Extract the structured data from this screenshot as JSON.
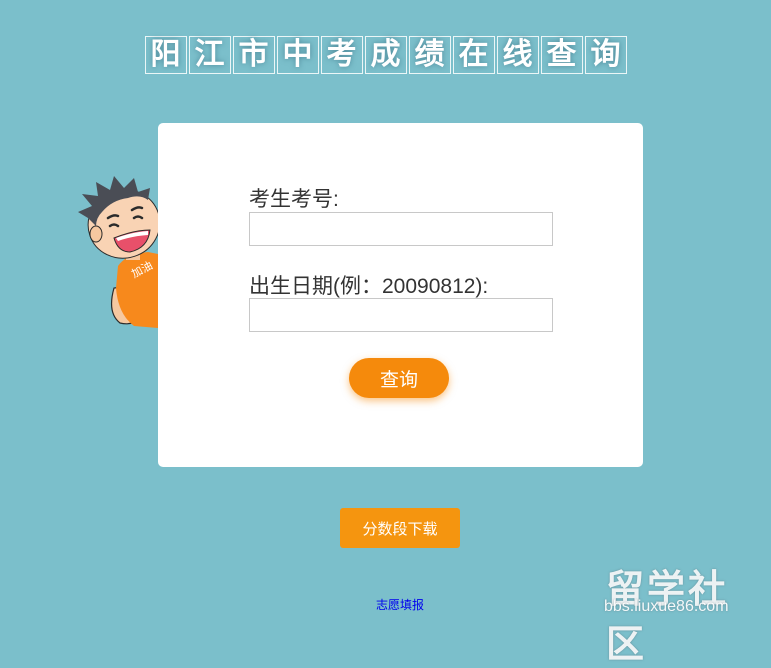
{
  "page": {
    "title_chars": [
      "阳",
      "江",
      "市",
      "中",
      "考",
      "成",
      "绩",
      "在",
      "线",
      "查",
      "询"
    ]
  },
  "form": {
    "id_label": "考生考号:",
    "id_value": "",
    "birth_label": "出生日期(例：20090812):",
    "birth_value": "",
    "query_button": "查询"
  },
  "download_button": "分数段下载",
  "link_text": "志愿填报",
  "mascot": {
    "shirt_text": "加油"
  },
  "watermark": {
    "main": "留学社区",
    "url": "bbs.liuxue86.com"
  },
  "colors": {
    "background": "#7bbfcb",
    "accent": "#f58a0c"
  }
}
